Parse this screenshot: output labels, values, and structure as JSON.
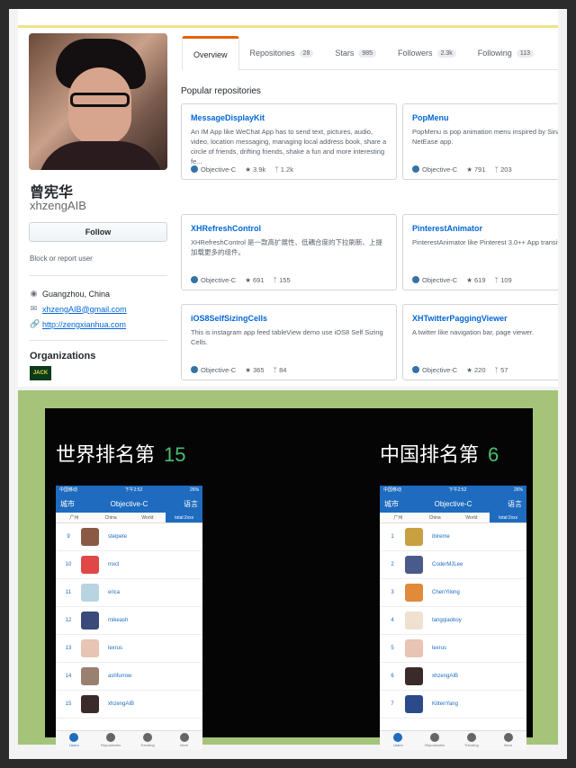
{
  "profile": {
    "name": "曾宪华",
    "username": "xhzengAIB",
    "follow_label": "Follow",
    "block_label": "Block or report user",
    "location": "Guangzhou, China",
    "email": "xhzengAIB@gmail.com",
    "website": "http://zengxianhua.com",
    "organizations_heading": "Organizations",
    "org_logo_text": "JACK"
  },
  "tabs": [
    {
      "label": "Overview",
      "count": ""
    },
    {
      "label": "Repositories",
      "count": "28"
    },
    {
      "label": "Stars",
      "count": "985"
    },
    {
      "label": "Followers",
      "count": "2.3k"
    },
    {
      "label": "Following",
      "count": "113"
    }
  ],
  "popular_heading": "Popular repositories",
  "repos": [
    {
      "name": "MessageDisplayKit",
      "desc": "An IM App like WeChat App has to send text, pictures, audio, video, location messaging, managing local address book, share a circle of friends, drifting friends, shake a fun and more interesting fe...",
      "lang": "Objective-C",
      "stars": "3.9k",
      "forks": "1.2k"
    },
    {
      "name": "PopMenu",
      "desc": "PopMenu is pop animation menu inspired by Sina weibo / NetEase app.",
      "lang": "Objective-C",
      "stars": "791",
      "forks": "203"
    },
    {
      "name": "XHRefreshControl",
      "desc": "XHRefreshControl 是一款高扩展性、低耦合度的下拉刷新、上提加载更多的组件。",
      "lang": "Objective-C",
      "stars": "691",
      "forks": "155"
    },
    {
      "name": "PinterestAnimator",
      "desc": "PinterestAnimator like Pinterest 3.0++ App transition animation.",
      "lang": "Objective-C",
      "stars": "619",
      "forks": "109"
    },
    {
      "name": "iOS8SelfSizingCells",
      "desc": "This is instagram app feed tableView demo use iOS8 Self Sizing Cells.",
      "lang": "Objective-C",
      "stars": "365",
      "forks": "84"
    },
    {
      "name": "XHTwitterPaggingViewer",
      "desc": "A twitter like navigation bar, page viewer.",
      "lang": "Objective-C",
      "stars": "220",
      "forks": "57"
    }
  ],
  "ranking": {
    "world_label": "世界排名第",
    "world_rank": "15",
    "china_label": "中国排名第",
    "china_rank": "6"
  },
  "phone": {
    "status_left": "中国移动",
    "status_time": "下午2:52",
    "status_right": "26%",
    "nav_left": "城市",
    "nav_title": "Objective-C",
    "nav_right": "语言",
    "seg": [
      "广州",
      "China",
      "World",
      "total:2xxx"
    ],
    "tabbar": [
      "Users",
      "Repositories",
      "Trending",
      "More"
    ]
  },
  "world_rows": [
    {
      "rank": "9",
      "user": "steipete",
      "color": "#8a5a44"
    },
    {
      "rank": "10",
      "user": "mxcl",
      "color": "#e04848"
    },
    {
      "rank": "11",
      "user": "erica",
      "color": "#b8d4e0"
    },
    {
      "rank": "12",
      "user": "mikeash",
      "color": "#3a4a7a"
    },
    {
      "rank": "13",
      "user": "lexrus",
      "color": "#e8c4b4"
    },
    {
      "rank": "14",
      "user": "ashfurrow",
      "color": "#9a8070"
    },
    {
      "rank": "15",
      "user": "xhzengAIB",
      "color": "#3a2a2a"
    }
  ],
  "china_rows": [
    {
      "rank": "1",
      "user": "ibireme",
      "color": "#c8a040"
    },
    {
      "rank": "2",
      "user": "CoderMJLee",
      "color": "#4a5a8a"
    },
    {
      "rank": "3",
      "user": "ChenYilong",
      "color": "#e08a3a"
    },
    {
      "rank": "4",
      "user": "tangqiaoboy",
      "color": "#f0e0d0"
    },
    {
      "rank": "5",
      "user": "lexrus",
      "color": "#e8c4b4"
    },
    {
      "rank": "6",
      "user": "xhzengAIB",
      "color": "#3a2a2a"
    },
    {
      "rank": "7",
      "user": "KittenYang",
      "color": "#2a4a8a"
    }
  ]
}
